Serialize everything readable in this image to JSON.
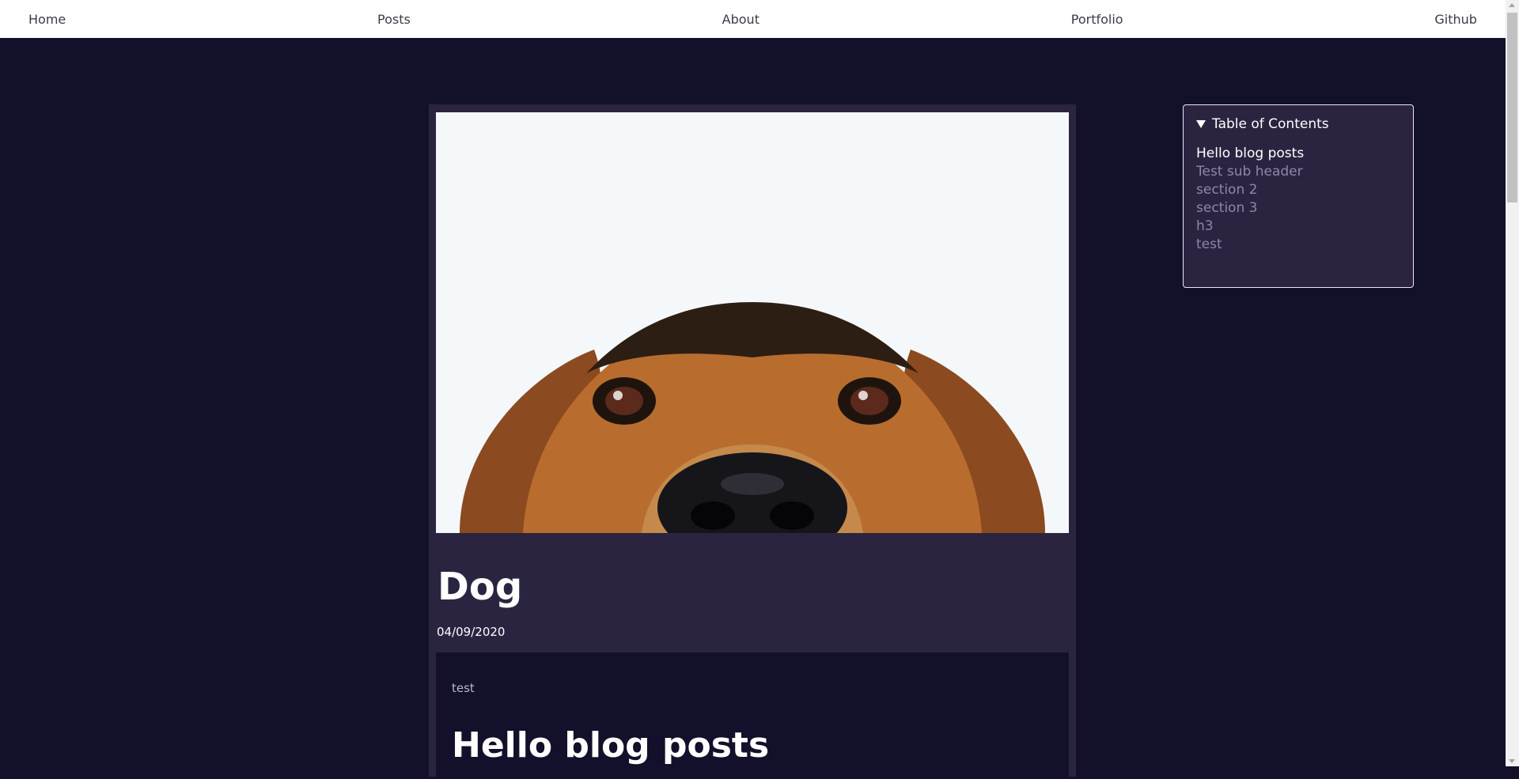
{
  "nav": {
    "items": [
      {
        "label": "Home"
      },
      {
        "label": "Posts"
      },
      {
        "label": "About"
      },
      {
        "label": "Portfolio"
      },
      {
        "label": "Github"
      }
    ]
  },
  "post": {
    "title": "Dog",
    "date": "04/09/2020",
    "body_text": "test",
    "heading": "Hello blog posts"
  },
  "toc": {
    "title": "Table of Contents",
    "items": [
      {
        "label": "Hello blog posts",
        "active": true
      },
      {
        "label": "Test sub header",
        "active": false
      },
      {
        "label": "section 2",
        "active": false
      },
      {
        "label": "section 3",
        "active": false
      },
      {
        "label": "h3",
        "active": false
      },
      {
        "label": "test",
        "active": false
      }
    ]
  },
  "colors": {
    "page_bg": "#12102a",
    "card_bg": "#2b2441",
    "nav_bg": "#ffffff",
    "text_primary": "#ffffff",
    "text_muted": "#8c88a6"
  }
}
